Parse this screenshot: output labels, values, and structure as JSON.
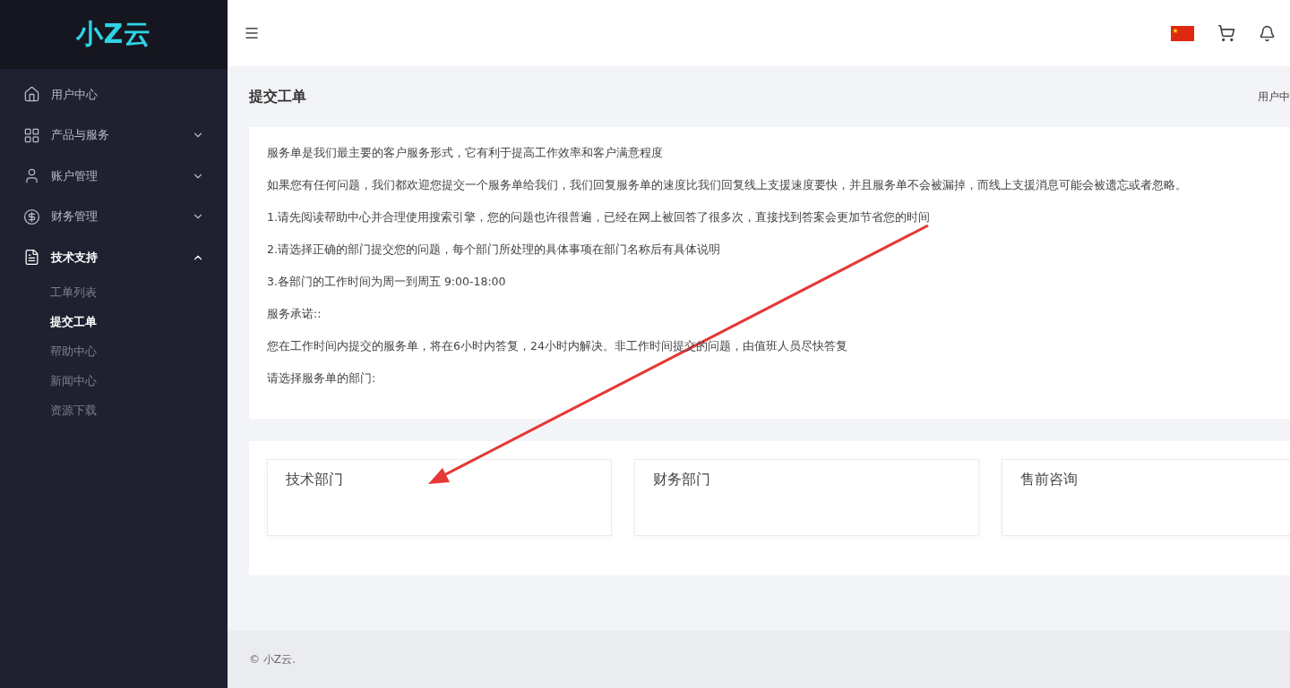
{
  "brand": {
    "logo": "小Z云"
  },
  "sidebar": {
    "items": [
      {
        "label": "用户中心",
        "selected": false
      },
      {
        "label": "产品与服务",
        "selected": false,
        "expanded": false
      },
      {
        "label": "账户管理",
        "selected": false,
        "expanded": false
      },
      {
        "label": "财务管理",
        "selected": false,
        "expanded": false
      },
      {
        "label": "技术支持",
        "selected": true,
        "expanded": true,
        "children": [
          {
            "label": "工单列表",
            "selected": false
          },
          {
            "label": "提交工单",
            "selected": true
          },
          {
            "label": "帮助中心",
            "selected": false
          },
          {
            "label": "新闻中心",
            "selected": false
          },
          {
            "label": "资源下载",
            "selected": false
          }
        ]
      }
    ]
  },
  "page": {
    "title": "提交工单",
    "breadcrumb": "用户中"
  },
  "intro": [
    "服务单是我们最主要的客户服务形式，它有利于提高工作效率和客户满意程度",
    "如果您有任何问题，我们都欢迎您提交一个服务单给我们，我们回复服务单的速度比我们回复线上支援速度要快，并且服务单不会被漏掉，而线上支援消息可能会被遗忘或者忽略。",
    "1.请先阅读帮助中心并合理使用搜索引擎，您的问题也许很普遍，已经在网上被回答了很多次，直接找到答案会更加节省您的时间",
    "2.请选择正确的部门提交您的问题，每个部门所处理的具体事项在部门名称后有具体说明",
    "3.各部门的工作时间为周一到周五 9:00-18:00",
    "服务承诺::",
    "您在工作时间内提交的服务单，将在6小时内答复，24小时内解决。非工作时间提交的问题，由值班人员尽快答复",
    "请选择服务单的部门:"
  ],
  "departments": [
    "技术部门",
    "财务部门",
    "售前咨询"
  ],
  "footer": "© 小Z云."
}
